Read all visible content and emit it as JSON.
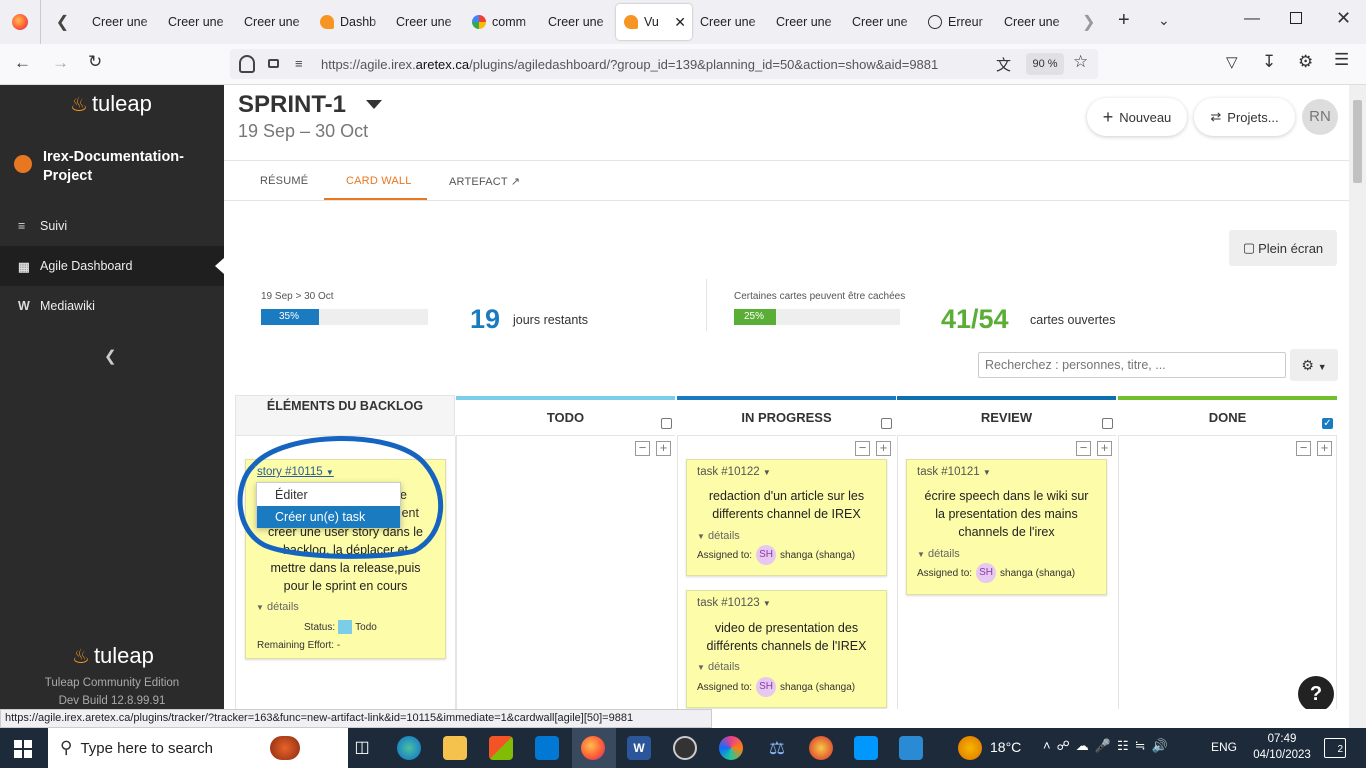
{
  "browser": {
    "tabs": [
      {
        "label": "Creer une",
        "icon": "document-icon"
      },
      {
        "label": "Creer une",
        "icon": "document-icon"
      },
      {
        "label": "Creer une",
        "icon": "document-icon"
      },
      {
        "label": "Dashb",
        "icon": "tuleap-icon"
      },
      {
        "label": "Creer une",
        "icon": "document-icon"
      },
      {
        "label": "comm",
        "icon": "google-icon"
      },
      {
        "label": "Creer une",
        "icon": "document-icon"
      },
      {
        "label": "Vu",
        "icon": "tuleap-icon",
        "active": true
      },
      {
        "label": "Creer une",
        "icon": "document-icon"
      },
      {
        "label": "Creer une",
        "icon": "document-icon"
      },
      {
        "label": "Creer une",
        "icon": "document-icon"
      },
      {
        "label": "Erreur",
        "icon": "info-icon"
      },
      {
        "label": "Creer une",
        "icon": "document-icon"
      }
    ],
    "url_prefix": "https://agile.irex.",
    "url_domain": "aretex.ca",
    "url_suffix": "/plugins/agiledashboard/?group_id=139&planning_id=50&action=show&aid=9881",
    "zoom": "90 %",
    "status_url": "https://agile.irex.aretex.ca/plugins/tracker/?tracker=163&func=new-artifact-link&id=10115&immediate=1&cardwall[agile][50]=9881"
  },
  "sidebar": {
    "logo": "tuleap",
    "project_name": "Irex-Documentation-Project",
    "items": [
      {
        "label": "Suivi",
        "icon": "list-icon"
      },
      {
        "label": "Agile Dashboard",
        "icon": "table-icon",
        "active": true
      },
      {
        "label": "Mediawiki",
        "icon": "wiki-icon"
      }
    ],
    "footer_logo": "tuleap",
    "edition": "Tuleap Community Edition",
    "build": "Dev Build 12.8.99.91"
  },
  "header": {
    "title": "SPRINT-1",
    "dates": "19 Sep – 30 Oct",
    "new_button": "Nouveau",
    "projects_button": "Projets...",
    "avatar": "RN"
  },
  "tabs": {
    "resume": "RÉSUMÉ",
    "cardwall": "CARD WALL",
    "artefact": "ARTEFACT"
  },
  "fullscreen": "Plein écran",
  "progress": {
    "date_range": "19 Sep > 30 Oct",
    "time_pct": "35%",
    "time_fill": 0.35,
    "days": "19",
    "days_label": "jours restants",
    "hidden_note": "Certaines cartes peuvent être cachées",
    "cards_pct": "25%",
    "cards_fill": 0.25,
    "cards": "41/54",
    "cards_label": "cartes ouvertes"
  },
  "search_placeholder": "Recherchez : personnes, titre, ...",
  "columns": {
    "backlog": "ÉLÉMENTS DU BACKLOG",
    "todo": "TODO",
    "inprogress": "IN PROGRESS",
    "review": "REVIEW",
    "done": "DONE"
  },
  "colors": {
    "todo": "#7ccde8",
    "inprogress": "#1b7bc0",
    "review": "#0e6fae",
    "done": "#6fbf2f",
    "accent": "#e87722",
    "annotation": "#1565c0"
  },
  "story": {
    "id": "story #10115",
    "title_visible_1": "e",
    "title_visible_2": "ent",
    "title_line3": "creer une user story dans le",
    "title_line4": "backlog, la déplacer et",
    "title_line5": "mettre dans la release,puis",
    "title_line6": "pour le sprint en cours",
    "details": "détails",
    "status_label": "Status:",
    "status_value": "Todo",
    "effort": "Remaining Effort: -",
    "menu": [
      "Éditer",
      "Créer un(e) task"
    ]
  },
  "tasks": {
    "t10122": {
      "id": "task #10122",
      "title": "redaction d'un article sur les differents channel de IREX",
      "details": "détails",
      "assigned": "Assigned to:",
      "user": "shanga (shanga)",
      "initials": "SH"
    },
    "t10123": {
      "id": "task #10123",
      "title": "video de presentation des différents channels de l'IREX",
      "details": "détails",
      "assigned": "Assigned to:",
      "user": "shanga (shanga)",
      "initials": "SH"
    },
    "t10121": {
      "id": "task #10121",
      "title": "écrire speech dans le wiki sur la presentation des mains channels de l'irex",
      "details": "détails",
      "assigned": "Assigned to:",
      "user": "shanga (shanga)",
      "initials": "SH"
    }
  },
  "taskbar": {
    "search": "Type here to search",
    "temp": "18°C",
    "lang": "ENG",
    "time": "07:49",
    "date": "04/10/2023",
    "notif": "2"
  }
}
